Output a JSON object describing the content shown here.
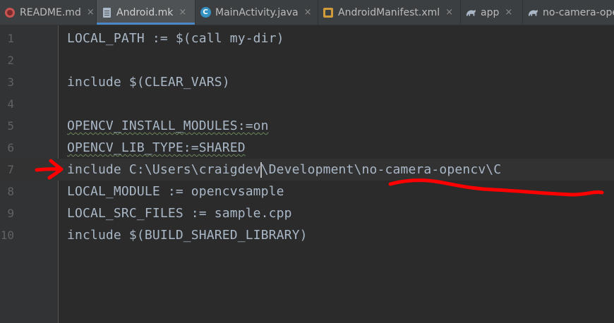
{
  "tabs": [
    {
      "label": "README.md",
      "icon": "markdown-icon",
      "active": false
    },
    {
      "label": "Android.mk",
      "icon": "text-file-icon",
      "active": true
    },
    {
      "label": "MainActivity.java",
      "icon": "java-class-icon",
      "active": false
    },
    {
      "label": "AndroidManifest.xml",
      "icon": "xml-file-icon",
      "active": false
    },
    {
      "label": "app",
      "icon": "gradle-icon",
      "active": false
    },
    {
      "label": "no-camera-ope",
      "icon": "gradle-icon",
      "active": false
    }
  ],
  "close_glyph": "×",
  "class_icon_letter": "C",
  "editor": {
    "lines": [
      {
        "num": "1",
        "text": "LOCAL_PATH := $(call my-dir)"
      },
      {
        "num": "2",
        "text": ""
      },
      {
        "num": "3",
        "text": "include $(CLEAR_VARS)"
      },
      {
        "num": "4",
        "text": ""
      },
      {
        "num": "5",
        "text": "OPENCV_INSTALL_MODULES:=on"
      },
      {
        "num": "6",
        "text": "OPENCV_LIB_TYPE:=SHARED"
      },
      {
        "num": "7",
        "text_before_caret": "include C:\\Users\\craigdev",
        "text_after_caret": "\\Development\\no-camera-opencv\\C"
      },
      {
        "num": "8",
        "text": "LOCAL_MODULE := opencvsample"
      },
      {
        "num": "9",
        "text": "LOCAL_SRC_FILES := sample.cpp"
      },
      {
        "num": "10",
        "text": "include $(BUILD_SHARED_LIBRARY)"
      }
    ],
    "caret_line": "7"
  },
  "colors": {
    "background": "#2b2b2b",
    "tabbar": "#3c3f41",
    "active_tab_underline": "#4a88c7",
    "code_text": "#a9b7c6",
    "line_number": "#606366",
    "annotation": "#ff0000"
  }
}
